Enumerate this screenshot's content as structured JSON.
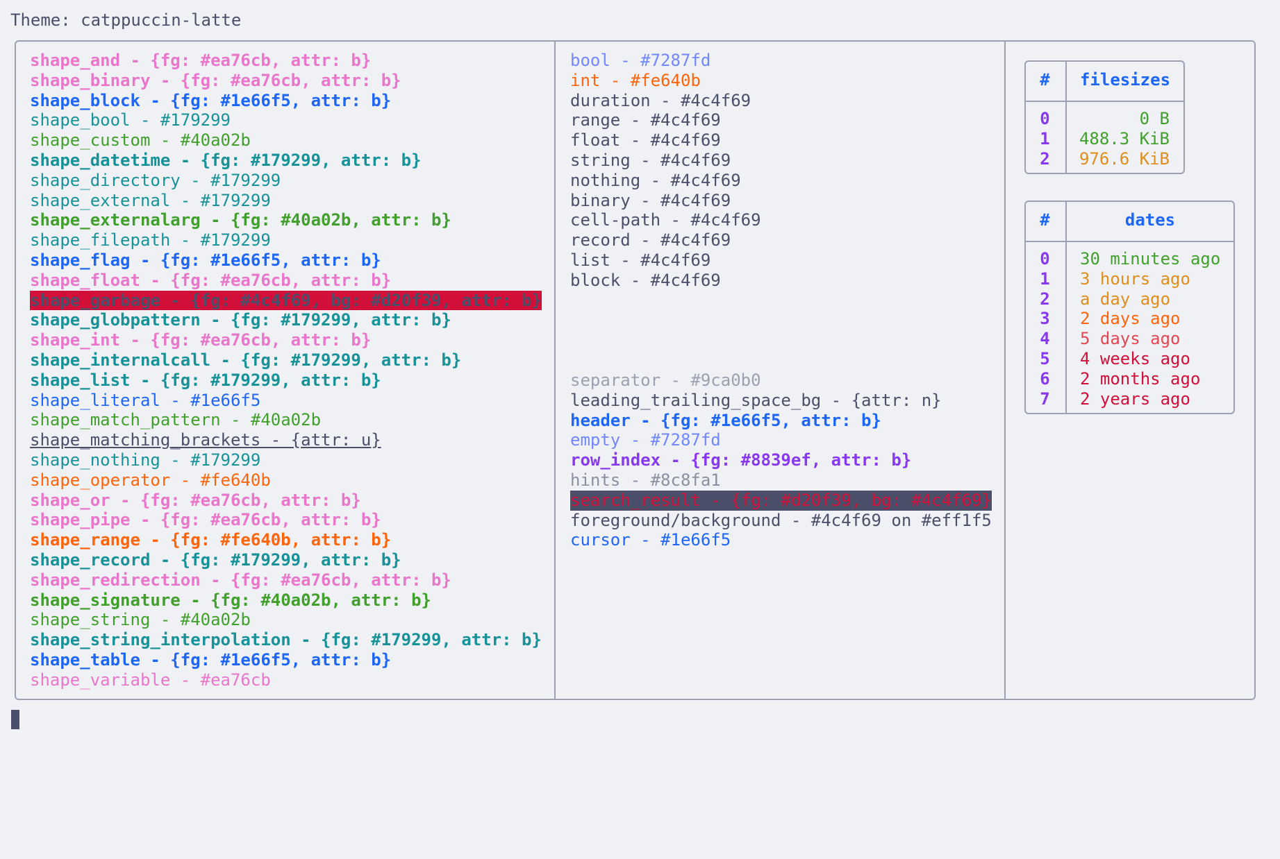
{
  "theme": {
    "text": "Theme: catppuccin-latte"
  },
  "colors": {
    "background": "#eff1f5",
    "foreground": "#4c4f69",
    "border": "#9ca0b0",
    "pink": "#ea76cb",
    "blue": "#1e66f5",
    "teal": "#179299",
    "green": "#40a02b",
    "orange": "#fe640b",
    "red": "#d20f39",
    "lavender": "#7287fd",
    "purple": "#8839ef",
    "overlay": "#8c8fa1",
    "yellow": "#df8e1d"
  },
  "shapes": [
    {
      "text": "shape_and - {fg: #ea76cb, attr: b}",
      "color": "#ea76cb",
      "bold": true
    },
    {
      "text": "shape_binary - {fg: #ea76cb, attr: b}",
      "color": "#ea76cb",
      "bold": true
    },
    {
      "text": "shape_block - {fg: #1e66f5, attr: b}",
      "color": "#1e66f5",
      "bold": true
    },
    {
      "text": "shape_bool - #179299",
      "color": "#179299"
    },
    {
      "text": "shape_custom - #40a02b",
      "color": "#40a02b"
    },
    {
      "text": "shape_datetime - {fg: #179299, attr: b}",
      "color": "#179299",
      "bold": true
    },
    {
      "text": "shape_directory - #179299",
      "color": "#179299"
    },
    {
      "text": "shape_external - #179299",
      "color": "#179299"
    },
    {
      "text": "shape_externalarg - {fg: #40a02b, attr: b}",
      "color": "#40a02b",
      "bold": true
    },
    {
      "text": "shape_filepath - #179299",
      "color": "#179299"
    },
    {
      "text": "shape_flag - {fg: #1e66f5, attr: b}",
      "color": "#1e66f5",
      "bold": true
    },
    {
      "text": "shape_float - {fg: #ea76cb, attr: b}",
      "color": "#ea76cb",
      "bold": true
    },
    {
      "text": "shape_garbage - {fg: #4c4f69, bg: #d20f39, attr: b}",
      "color": "#4c4f69",
      "bg": "#d20f39",
      "bold": true
    },
    {
      "text": "shape_globpattern - {fg: #179299, attr: b}",
      "color": "#179299",
      "bold": true
    },
    {
      "text": "shape_int - {fg: #ea76cb, attr: b}",
      "color": "#ea76cb",
      "bold": true
    },
    {
      "text": "shape_internalcall - {fg: #179299, attr: b}",
      "color": "#179299",
      "bold": true
    },
    {
      "text": "shape_list - {fg: #179299, attr: b}",
      "color": "#179299",
      "bold": true
    },
    {
      "text": "shape_literal - #1e66f5",
      "color": "#1e66f5"
    },
    {
      "text": "shape_match_pattern - #40a02b",
      "color": "#40a02b"
    },
    {
      "text": "shape_matching_brackets - {attr: u}",
      "color": "#4c4f69",
      "underline": true
    },
    {
      "text": "shape_nothing - #179299",
      "color": "#179299"
    },
    {
      "text": "shape_operator - #fe640b",
      "color": "#fe640b"
    },
    {
      "text": "shape_or - {fg: #ea76cb, attr: b}",
      "color": "#ea76cb",
      "bold": true
    },
    {
      "text": "shape_pipe - {fg: #ea76cb, attr: b}",
      "color": "#ea76cb",
      "bold": true
    },
    {
      "text": "shape_range - {fg: #fe640b, attr: b}",
      "color": "#fe640b",
      "bold": true
    },
    {
      "text": "shape_record - {fg: #179299, attr: b}",
      "color": "#179299",
      "bold": true
    },
    {
      "text": "shape_redirection - {fg: #ea76cb, attr: b}",
      "color": "#ea76cb",
      "bold": true
    },
    {
      "text": "shape_signature - {fg: #40a02b, attr: b}",
      "color": "#40a02b",
      "bold": true
    },
    {
      "text": "shape_string - #40a02b",
      "color": "#40a02b"
    },
    {
      "text": "shape_string_interpolation - {fg: #179299, attr: b}",
      "color": "#179299",
      "bold": true
    },
    {
      "text": "shape_table - {fg: #1e66f5, attr: b}",
      "color": "#1e66f5",
      "bold": true
    },
    {
      "text": "shape_variable - #ea76cb",
      "color": "#ea76cb"
    }
  ],
  "types": [
    {
      "text": "bool - #7287fd",
      "color": "#7287fd"
    },
    {
      "text": "int - #fe640b",
      "color": "#fe640b"
    },
    {
      "text": "duration - #4c4f69",
      "color": "#4c4f69"
    },
    {
      "text": "range - #4c4f69",
      "color": "#4c4f69"
    },
    {
      "text": "float - #4c4f69",
      "color": "#4c4f69"
    },
    {
      "text": "string - #4c4f69",
      "color": "#4c4f69"
    },
    {
      "text": "nothing - #4c4f69",
      "color": "#4c4f69"
    },
    {
      "text": "binary - #4c4f69",
      "color": "#4c4f69"
    },
    {
      "text": "cell-path - #4c4f69",
      "color": "#4c4f69"
    },
    {
      "text": "record - #4c4f69",
      "color": "#4c4f69"
    },
    {
      "text": "list - #4c4f69",
      "color": "#4c4f69"
    },
    {
      "text": "block - #4c4f69",
      "color": "#4c4f69"
    }
  ],
  "misc": [
    {
      "text": "separator - #9ca0b0",
      "color": "#9ca0b0"
    },
    {
      "text": "leading_trailing_space_bg - {attr: n}",
      "color": "#4c4f69"
    },
    {
      "text": "header - {fg: #1e66f5, attr: b}",
      "color": "#1e66f5",
      "bold": true
    },
    {
      "text": "empty - #7287fd",
      "color": "#7287fd"
    },
    {
      "text": "row_index - {fg: #8839ef, attr: b}",
      "color": "#8839ef",
      "bold": true
    },
    {
      "text": "hints - #8c8fa1",
      "color": "#8c8fa1"
    },
    {
      "text": "search_result - {fg: #d20f39, bg: #4c4f69}",
      "color": "#d20f39",
      "bg": "#4c4f69"
    },
    {
      "text": "foreground/background - #4c4f69 on #eff1f5",
      "color": "#4c4f69"
    },
    {
      "text": "cursor - #1e66f5",
      "color": "#1e66f5"
    }
  ],
  "filesizes": {
    "index_header": "#",
    "header": "filesizes",
    "rows": [
      {
        "index": "0",
        "value": "0 B",
        "color": "#40a02b"
      },
      {
        "index": "1",
        "value": "488.3 KiB",
        "color": "#40a02b"
      },
      {
        "index": "2",
        "value": "976.6 KiB",
        "color": "#df8e1d"
      }
    ]
  },
  "dates": {
    "index_header": "#",
    "header": "dates",
    "rows": [
      {
        "index": "0",
        "value": "30 minutes ago",
        "color": "#40a02b"
      },
      {
        "index": "1",
        "value": "3 hours ago",
        "color": "#df8e1d"
      },
      {
        "index": "2",
        "value": "a day ago",
        "color": "#df8e1d"
      },
      {
        "index": "3",
        "value": "2 days ago",
        "color": "#fe640b"
      },
      {
        "index": "4",
        "value": "5 days ago",
        "color": "#e64553"
      },
      {
        "index": "5",
        "value": "4 weeks ago",
        "color": "#d20f39"
      },
      {
        "index": "6",
        "value": "2 months ago",
        "color": "#d20f39"
      },
      {
        "index": "7",
        "value": "2 years ago",
        "color": "#d20f39"
      }
    ]
  }
}
